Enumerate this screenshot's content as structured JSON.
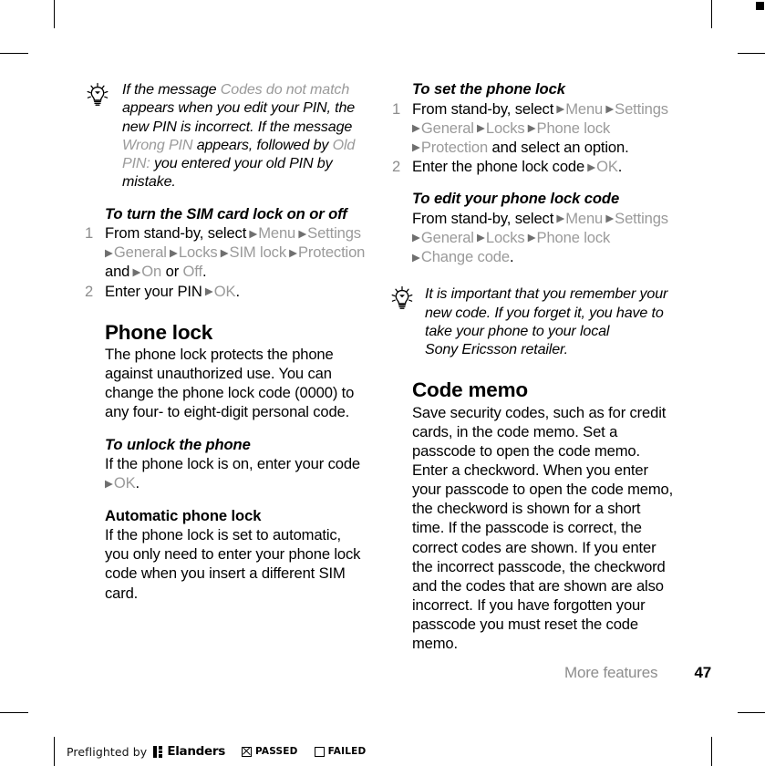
{
  "document": {
    "footer_chapter": "More features",
    "footer_page": "47"
  },
  "icons": {
    "tip": "lightbulb-icon"
  },
  "left_column": {
    "tip1": {
      "parts": [
        {
          "text": "If the message ",
          "style": "italic"
        },
        {
          "text": "Codes do not match",
          "style": "gray"
        },
        {
          "text": " appears when you edit your PIN, the new PIN is incorrect. If the message ",
          "style": "italic"
        },
        {
          "text": "Wrong PIN",
          "style": "gray"
        },
        {
          "text": " appears, followed by ",
          "style": "italic"
        },
        {
          "text": "Old PIN:",
          "style": "gray"
        },
        {
          "text": " you entered your old PIN by mistake.",
          "style": "italic"
        }
      ],
      "line1_a": "If the message",
      "line1_b": "Codes do not match",
      "line2": "appears when you edit your PIN, the",
      "line3": "new PIN is incorrect. If the message",
      "line4_a": "Wrong PIN",
      "line4_b": "appears, followed by",
      "line4_c": "Old",
      "line5_a": "PIN:",
      "line5_b": "you entered your old PIN by",
      "line6": "mistake."
    },
    "sim_lock": {
      "heading": "To turn the SIM card lock on or off",
      "step1": {
        "num": "1",
        "intro": "From stand-by, select",
        "menu": [
          "Menu",
          "Settings",
          "General",
          "Locks",
          "SIM lock",
          "Protection"
        ],
        "and": "and",
        "on": "On",
        "or": "or",
        "off": "Off",
        "period": "."
      },
      "step2": {
        "num": "2",
        "intro": "Enter your PIN",
        "menu": [
          "OK"
        ],
        "period": "."
      }
    },
    "phone_lock": {
      "heading": "Phone lock",
      "paragraph": "The phone lock protects the phone against unauthorized use. You can change the phone lock code (0000) to any four- to eight-digit personal code."
    },
    "unlock": {
      "heading": "To unlock the phone",
      "line1": "If the phone lock is on, enter your",
      "line2_a": "code",
      "line2_b": "OK",
      "line2_c": "."
    },
    "automatic": {
      "heading": "Automatic phone lock",
      "paragraph": "If the phone lock is set to automatic, you only need to enter your phone lock code when you insert a different SIM card."
    }
  },
  "right_column": {
    "set_phone_lock": {
      "heading": "To set the phone lock",
      "step1": {
        "num": "1",
        "intro": "From stand-by, select",
        "menu": [
          "Menu",
          "Settings",
          "General",
          "Locks",
          "Phone lock",
          "Protection"
        ],
        "tail": "and select an option."
      },
      "step2": {
        "num": "2",
        "intro": "Enter the phone lock code",
        "menu": [
          "OK"
        ],
        "period": "."
      }
    },
    "edit_code": {
      "heading": "To edit your phone lock code",
      "intro": "From stand-by, select",
      "menu": [
        "Menu",
        "Settings",
        "General",
        "Locks",
        "Phone lock",
        "Change code"
      ],
      "period": "."
    },
    "tip2": {
      "line1": "It is important that you remember your",
      "line2": "new code. If you forget it, you have to",
      "line3": "take your phone to your local",
      "line4": "Sony Ericsson retailer."
    },
    "code_memo": {
      "heading": "Code memo",
      "paragraph": "Save security codes, such as for credit cards, in the code memo. Set a passcode to open the code memo. Enter a checkword. When you enter your passcode to open the code memo, the checkword is shown for a short time. If the passcode is correct, the correct codes are shown. If you enter the incorrect passcode, the checkword and the codes that are shown are also incorrect. If you have forgotten your passcode you must reset the code memo."
    }
  },
  "preflight": {
    "label": "Preflighted by",
    "brand": "Elanders",
    "passed": "PASSED",
    "failed": "FAILED"
  }
}
